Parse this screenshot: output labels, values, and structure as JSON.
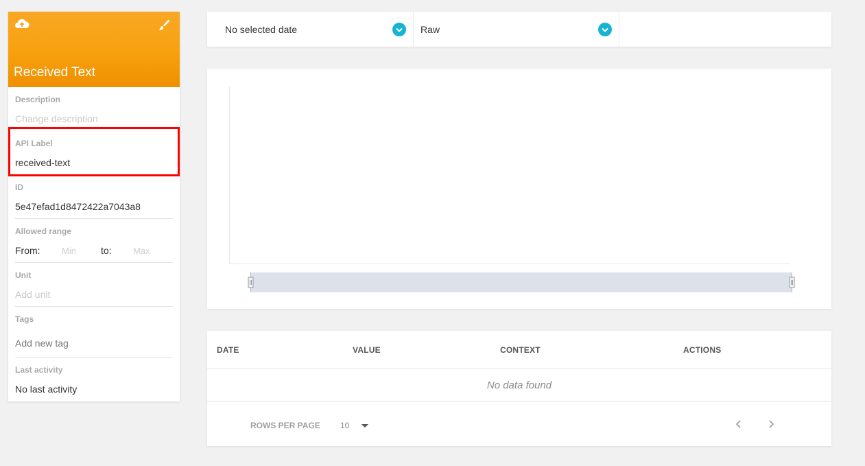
{
  "sidebar": {
    "title": "Received Text",
    "description": {
      "label": "Description",
      "placeholder": "Change description"
    },
    "api_label": {
      "label": "API Label",
      "value": "received-text"
    },
    "id": {
      "label": "ID",
      "value": "5e47efad1d8472422a7043a8"
    },
    "allowed_range": {
      "label": "Allowed range",
      "from_label": "From:",
      "from_placeholder": "Min",
      "to_label": "to:",
      "to_placeholder": "Max"
    },
    "unit": {
      "label": "Unit",
      "placeholder": "Add unit"
    },
    "tags": {
      "label": "Tags",
      "placeholder": "Add new tag"
    },
    "last_activity": {
      "label": "Last activity",
      "value": "No last activity"
    },
    "header_color": "#f7a10f",
    "icons": {
      "left": "cloud-upload-icon",
      "right": "paint-brush-icon"
    }
  },
  "filters": {
    "date_select": "No selected date",
    "mode_select": "Raw",
    "accent": "#17b3d3"
  },
  "table": {
    "columns": [
      "DATE",
      "VALUE",
      "CONTEXT",
      "ACTIONS"
    ],
    "empty_message": "No data found",
    "rows_per_page_label": "ROWS PER PAGE",
    "rows_per_page_value": "10"
  }
}
